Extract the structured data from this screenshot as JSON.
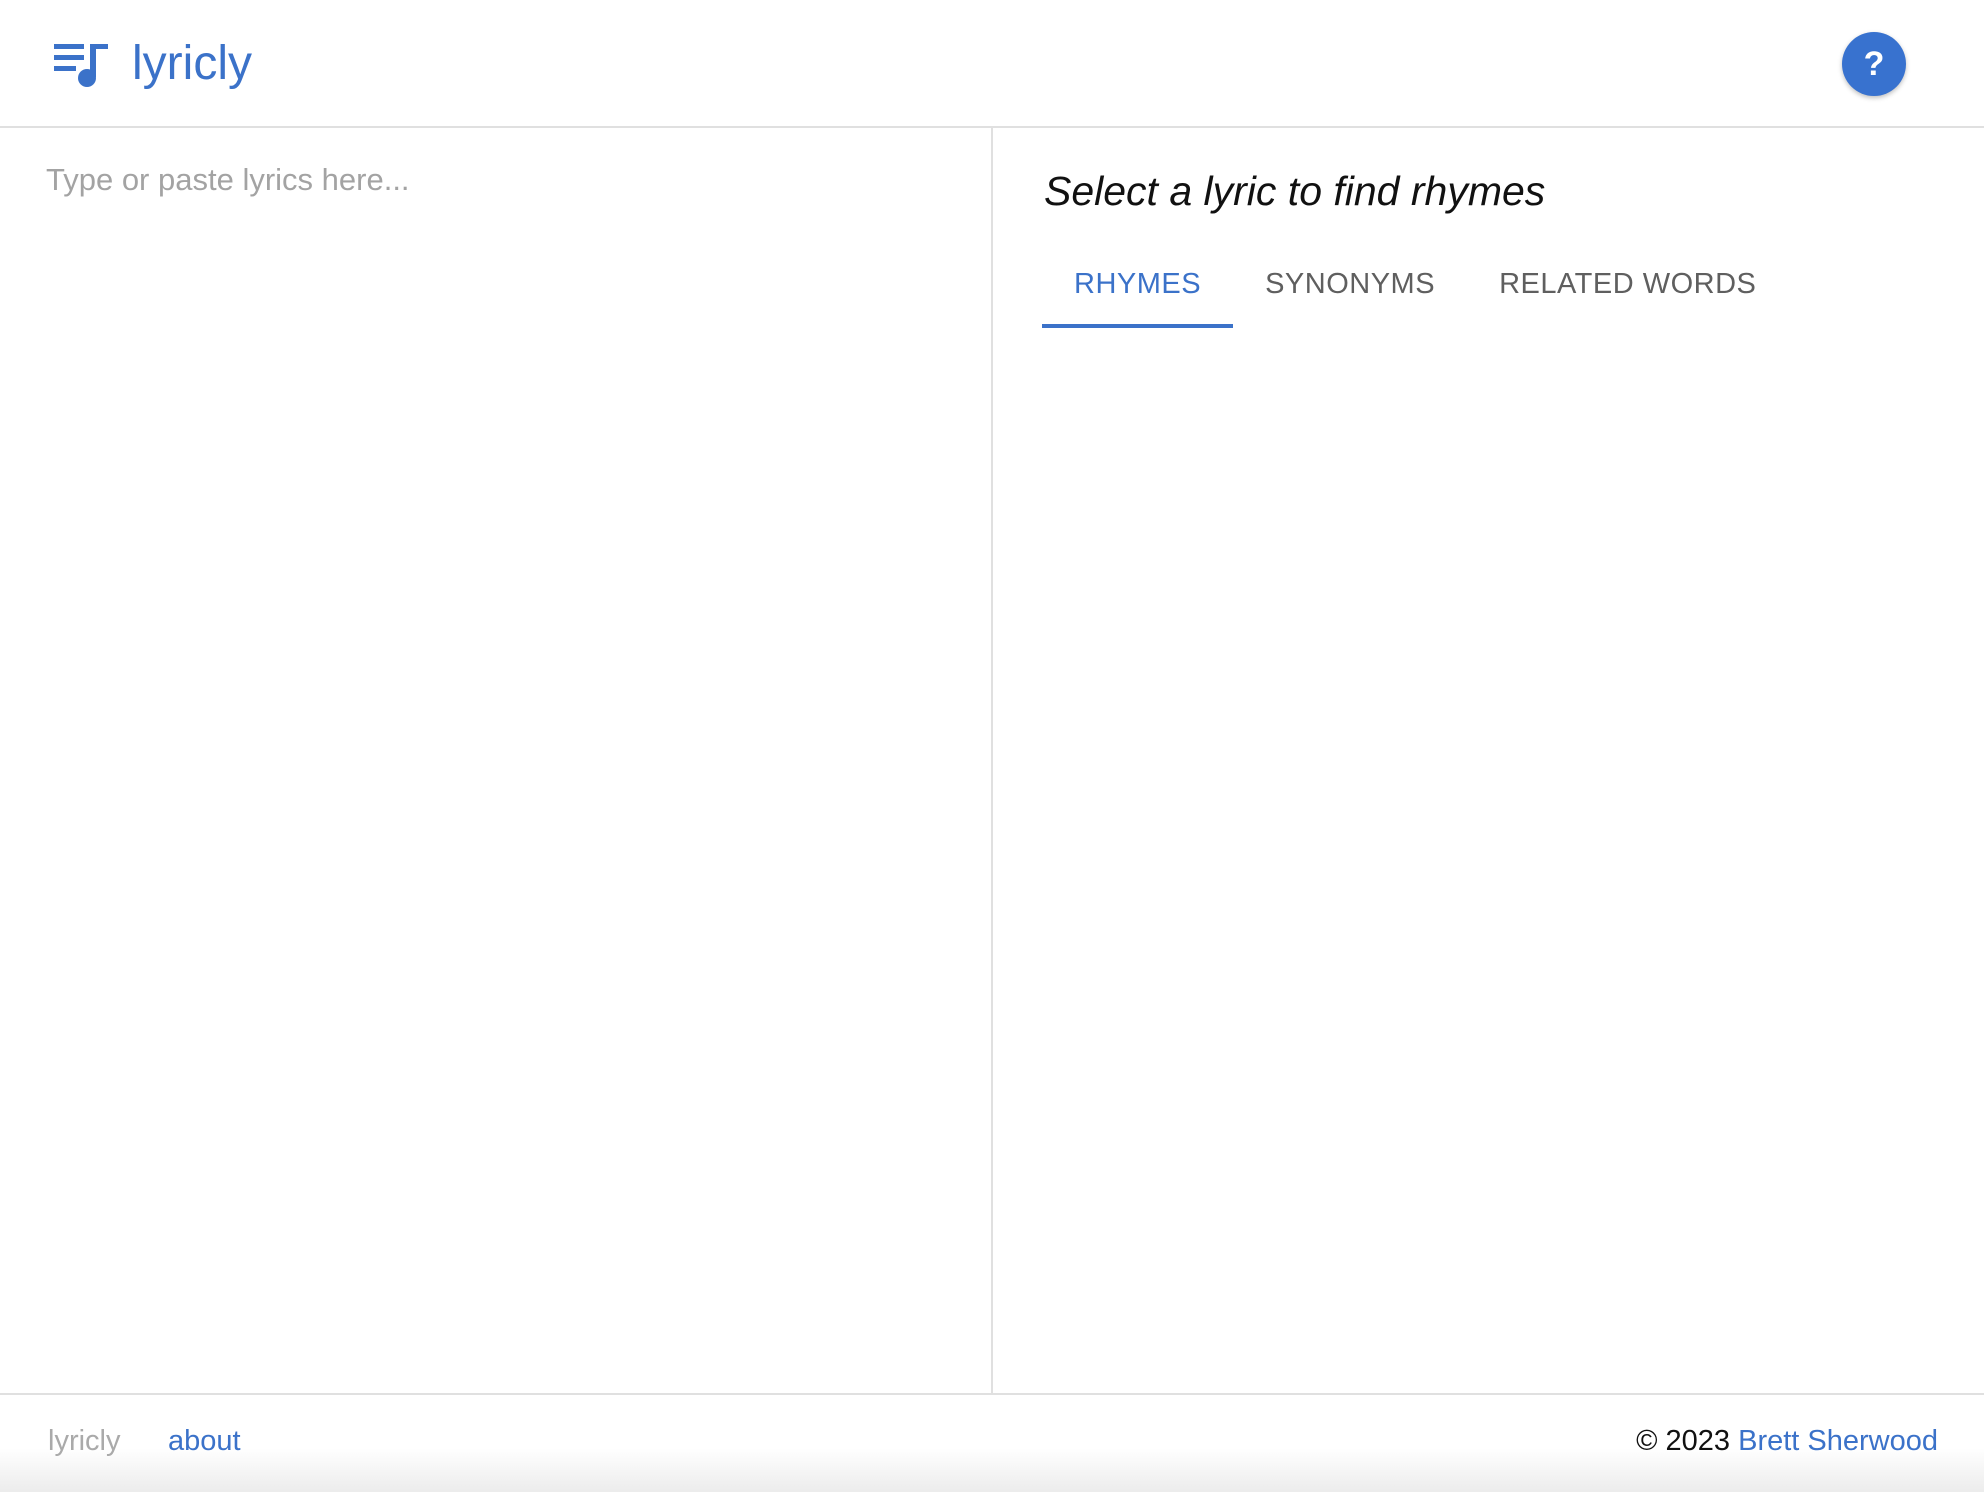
{
  "header": {
    "brand_name": "lyricly",
    "brand_icon": "playlist-music-icon",
    "help_label": "?"
  },
  "editor": {
    "placeholder": "Type or paste lyrics here...",
    "value": ""
  },
  "panel": {
    "prompt": "Select a lyric to find rhymes",
    "tabs": [
      {
        "label": "RHYMES",
        "active": true
      },
      {
        "label": "SYNONYMS",
        "active": false
      },
      {
        "label": "RELATED WORDS",
        "active": false
      }
    ]
  },
  "footer": {
    "brand": "lyricly",
    "about_label": "about",
    "copyright": "© 2023",
    "author": "Brett Sherwood"
  },
  "colors": {
    "accent": "#3b72c9",
    "help_button": "#3872cf",
    "divider": "#e0e0e0",
    "muted_text": "#a3a3a3"
  }
}
